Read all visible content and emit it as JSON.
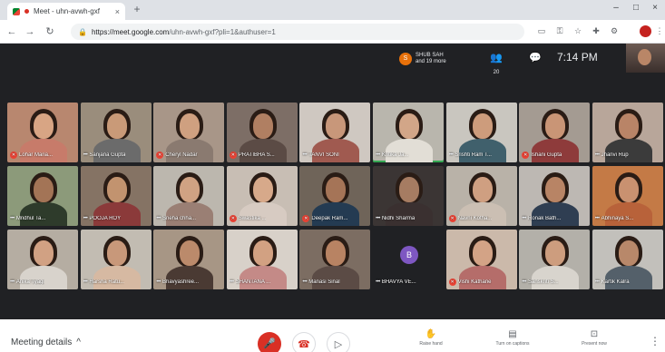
{
  "browser": {
    "tab_title": "Meet - uhn-avwh-gxf",
    "tab_close": "×",
    "new_tab": "+",
    "window_controls": [
      "–",
      "□",
      "×"
    ],
    "url_host": "https://meet.google.com",
    "url_path": "/uhn-avwh-gxf?pli=1&authuser=1",
    "nav": {
      "back": "←",
      "forward": "→",
      "reload": "↻"
    }
  },
  "meet_header": {
    "presenter_name": "SHUB SAH",
    "presenter_others": "and 19 more",
    "presenter_initial": "S",
    "people_icon": "people-icon",
    "people_count": "20",
    "chat_icon": "chat-icon",
    "time": "7:14 PM"
  },
  "participants": [
    {
      "name": "Lohar Maria...",
      "muted": true,
      "bg": "#b8876f",
      "skin": "#d8a584",
      "cloth": "#c77b6a"
    },
    {
      "name": "Sanjana Gupta",
      "muted": false,
      "bg": "#9a8d7c",
      "skin": "#c99a78",
      "cloth": "#6b6b6b"
    },
    {
      "name": "Cheryl Nadar",
      "muted": true,
      "bg": "#a89688",
      "skin": "#cfa080",
      "cloth": "#8a7a70"
    },
    {
      "name": "PRATIBHA S...",
      "muted": true,
      "bg": "#7d6e66",
      "skin": "#b07f62",
      "cloth": "#5b4b45"
    },
    {
      "name": "TANVI SONI",
      "muted": false,
      "bg": "#cfc8c1",
      "skin": "#c8977a",
      "cloth": "#a05a50"
    },
    {
      "name": "Kritika Ja...",
      "muted": false,
      "bg": "#b9b6ad",
      "skin": "#d2a688",
      "cloth": "#e2ded6",
      "active": true
    },
    {
      "name": "Srishti Ram T...",
      "muted": false,
      "bg": "#c9c6bf",
      "skin": "#cd9c7c",
      "cloth": "#40606c"
    },
    {
      "name": "Ishani Gupta",
      "muted": true,
      "bg": "#a49b92",
      "skin": "#c99576",
      "cloth": "#8e3b3b"
    },
    {
      "name": "Jhanvi Rup",
      "muted": false,
      "bg": "#b8a69a",
      "skin": "#b98467",
      "cloth": "#3b3b3b"
    },
    {
      "name": "Mridhul Ta...",
      "muted": false,
      "bg": "#8c9a7a",
      "skin": "#a37456",
      "cloth": "#2e3b2b"
    },
    {
      "name": "POOJA ROY",
      "muted": false,
      "bg": "#857364",
      "skin": "#c2936f",
      "cloth": "#8b3a3a"
    },
    {
      "name": "Sneha chha...",
      "muted": false,
      "bg": "#bcb7ae",
      "skin": "#d0a283",
      "cloth": "#9a7f74"
    },
    {
      "name": "Swastika ...",
      "muted": true,
      "bg": "#c8beb4",
      "skin": "#d7a98a",
      "cloth": "#d7cbc2"
    },
    {
      "name": "Deepak Ram...",
      "muted": true,
      "bg": "#6f6459",
      "skin": "#a57457",
      "cloth": "#243b52"
    },
    {
      "name": "Nidhi Sharma",
      "muted": false,
      "bg": "#3b3534",
      "skin": "#a67c62",
      "cloth": "#3a3030"
    },
    {
      "name": "Navni Kotha...",
      "muted": true,
      "bg": "#b9b2a8",
      "skin": "#cf9f81",
      "cloth": "#cbbfb3"
    },
    {
      "name": "Ronak Bath...",
      "muted": false,
      "bg": "#bdb8b3",
      "skin": "#b88465",
      "cloth": "#2f3e52"
    },
    {
      "name": "Abhinaya S...",
      "muted": false,
      "bg": "#c47a46",
      "skin": "#c99170",
      "cloth": "#b8623a"
    },
    {
      "name": "Anika Tyagi",
      "muted": false,
      "bg": "#b5ada2",
      "skin": "#d1a183",
      "cloth": "#d8d3cc"
    },
    {
      "name": "Harsha Ratu...",
      "muted": false,
      "bg": "#c2bcb2",
      "skin": "#c8987a",
      "cloth": "#d6b9a2"
    },
    {
      "name": "Bhavyashree...",
      "muted": false,
      "bg": "#a79685",
      "skin": "#bb8a6b",
      "cloth": "#4a3a33"
    },
    {
      "name": "SHANTANA ...",
      "muted": false,
      "bg": "#d8d1c9",
      "skin": "#d2a182",
      "cloth": "#c48a87"
    },
    {
      "name": "Manasi Sinal",
      "muted": false,
      "bg": "#7c6d62",
      "skin": "#b88363",
      "cloth": "#5b4b45"
    },
    {
      "name": "BHAVYA VE...",
      "muted": false,
      "bg": "#202124",
      "initial": "B"
    },
    {
      "name": "Vishi Kathane",
      "muted": true,
      "bg": "#cbb9aa",
      "skin": "#d3a386",
      "cloth": "#b56d6a"
    },
    {
      "name": "Sanskriti S...",
      "muted": false,
      "bg": "#b3b0a9",
      "skin": "#cd9d7e",
      "cloth": "#d8d4cd"
    },
    {
      "name": "Kartik Kalra",
      "muted": false,
      "bg": "#c2c0bb",
      "skin": "#b8886a",
      "cloth": "#54606a"
    }
  ],
  "bottom_bar": {
    "meeting_details": "Meeting details",
    "details_chevron": "^",
    "mic_icon": "mic-off-icon",
    "hangup_icon": "call-end-icon",
    "camera_icon": "camera-icon",
    "raise_hand": "Raise hand",
    "captions": "Turn on captions",
    "present": "Present now",
    "more": "⋮"
  }
}
